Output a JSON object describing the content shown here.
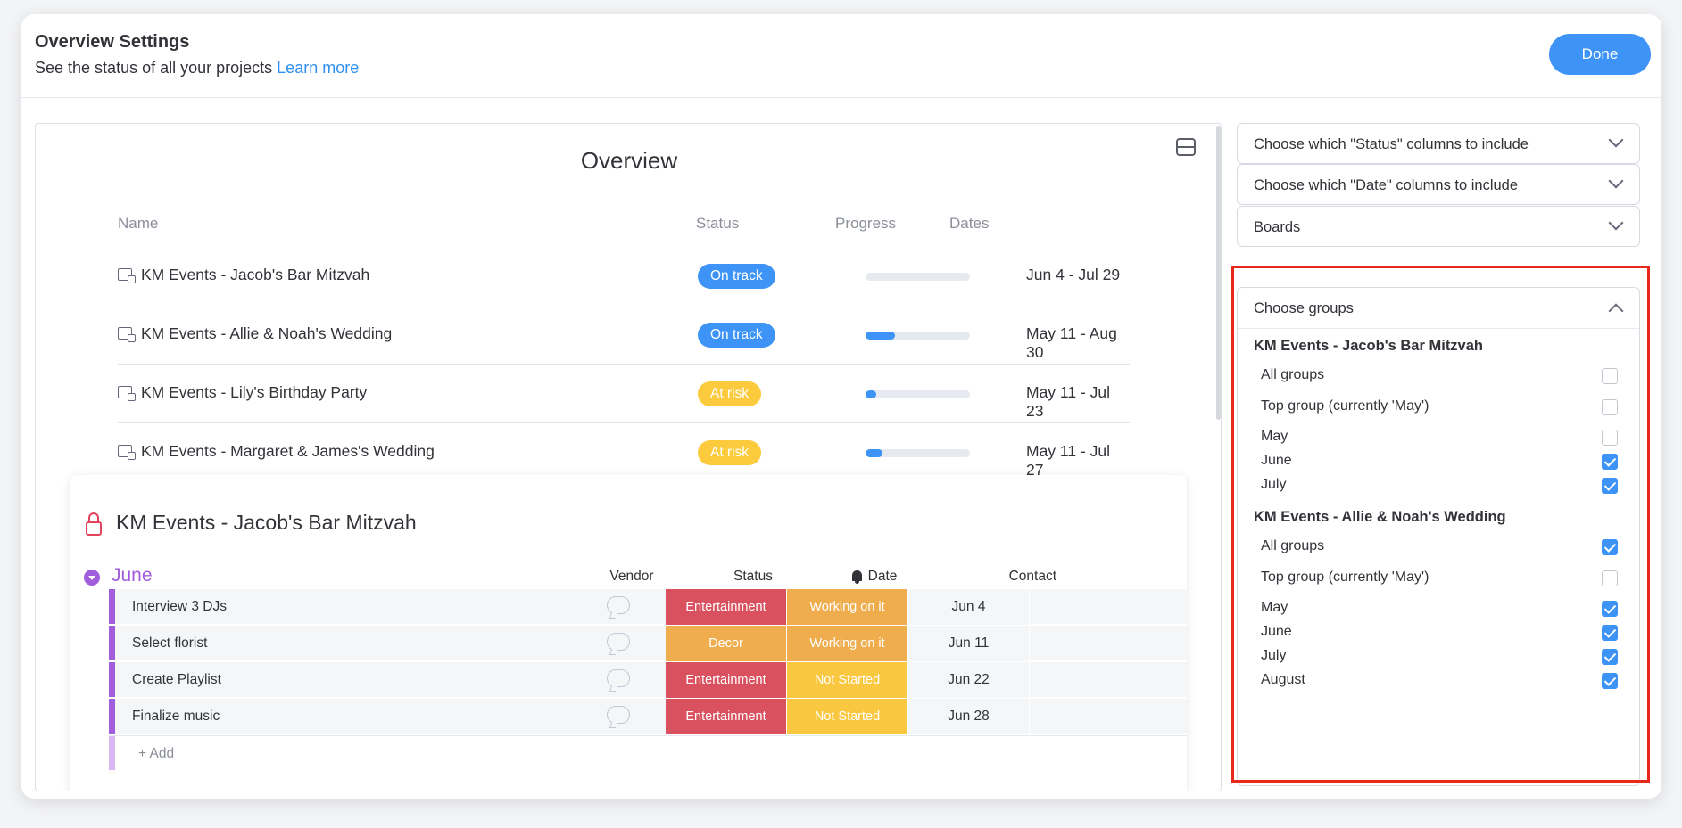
{
  "header": {
    "title": "Overview Settings",
    "subtitle": "See the status of all your projects",
    "learn_more": "Learn more",
    "done_label": "Done"
  },
  "overview": {
    "title": "Overview",
    "columns": {
      "name": "Name",
      "status": "Status",
      "progress": "Progress",
      "dates": "Dates"
    },
    "projects": [
      {
        "name": "KM Events - Jacob's Bar Mitzvah",
        "status": "On track",
        "status_color": "#3d94f6",
        "progress": 0,
        "dates": "Jun 4 - Jul 29"
      },
      {
        "name": "KM Events - Allie & Noah's Wedding",
        "status": "On track",
        "status_color": "#3d94f6",
        "progress": 0.28,
        "dates": "May 11 - Aug 30"
      },
      {
        "name": "KM Events - Lily's Birthday Party",
        "status": "At risk",
        "status_color": "#fbcb3d",
        "progress": 0.1,
        "dates": "May 11 - Jul 23"
      },
      {
        "name": "KM Events - Margaret & James's Wedding",
        "status": "At risk",
        "status_color": "#fbcb3d",
        "progress": 0.16,
        "dates": "May 11 - Jul 27"
      }
    ]
  },
  "board": {
    "title": "KM Events - Jacob's Bar Mitzvah",
    "group": "June",
    "columns": {
      "vendor": "Vendor",
      "status": "Status",
      "date": "Date",
      "contact": "Contact"
    },
    "items": [
      {
        "name": "Interview 3 DJs",
        "vendor": "Entertainment",
        "vendor_color": "#d9515f",
        "status": "Working on it",
        "status_color": "#f0ad4e",
        "date": "Jun 4"
      },
      {
        "name": "Select florist",
        "vendor": "Decor",
        "vendor_color": "#f0ad4e",
        "status": "Working on it",
        "status_color": "#f0ad4e",
        "date": "Jun 11"
      },
      {
        "name": "Create Playlist",
        "vendor": "Entertainment",
        "vendor_color": "#d9515f",
        "status": "Not Started",
        "status_color": "#f9c740",
        "date": "Jun 22"
      },
      {
        "name": "Finalize music",
        "vendor": "Entertainment",
        "vendor_color": "#d9515f",
        "status": "Not Started",
        "status_color": "#f9c740",
        "date": "Jun 28"
      }
    ],
    "add_label": "+ Add"
  },
  "settings": {
    "status_columns": "Choose which \"Status\" columns to include",
    "date_columns": "Choose which \"Date\" columns to include",
    "boards": "Boards",
    "groups_title": "Choose groups",
    "sections": [
      {
        "title": "KM Events - Jacob's Bar Mitzvah",
        "options": [
          {
            "label": "All groups",
            "checked": false
          },
          {
            "label": "Top group (currently 'May')",
            "checked": false
          },
          {
            "label": "May",
            "checked": false
          },
          {
            "label": "June",
            "checked": true
          },
          {
            "label": "July",
            "checked": true
          }
        ]
      },
      {
        "title": "KM Events - Allie & Noah's Wedding",
        "options": [
          {
            "label": "All groups",
            "checked": true
          },
          {
            "label": "Top group (currently 'May')",
            "checked": false
          },
          {
            "label": "May",
            "checked": true
          },
          {
            "label": "June",
            "checked": true
          },
          {
            "label": "July",
            "checked": true
          },
          {
            "label": "August",
            "checked": true
          }
        ]
      }
    ]
  }
}
